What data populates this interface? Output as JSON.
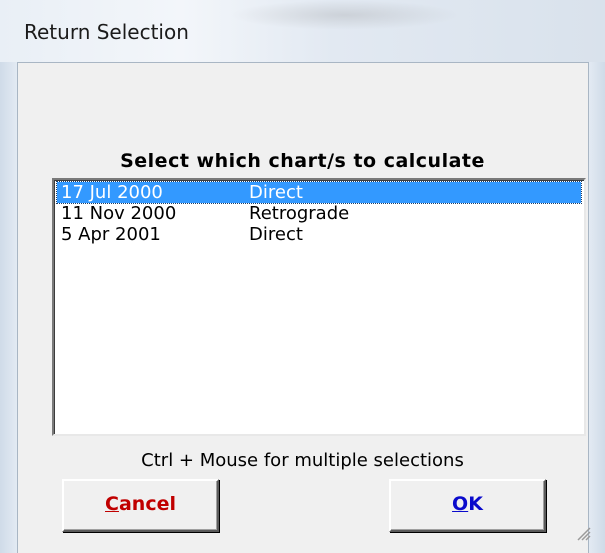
{
  "window": {
    "title": "Return Selection"
  },
  "dialog": {
    "heading": "Select which chart/s to calculate",
    "hint": "Ctrl + Mouse for multiple selections"
  },
  "list": {
    "items": [
      {
        "date": "17 Jul 2000",
        "kind": "Direct",
        "selected": true
      },
      {
        "date": "11 Nov 2000",
        "kind": "Retrograde",
        "selected": false
      },
      {
        "date": "5 Apr 2001",
        "kind": "Direct",
        "selected": false
      }
    ]
  },
  "buttons": {
    "cancel": {
      "mnemonic": "C",
      "rest": "ancel",
      "color": "#c00000"
    },
    "ok": {
      "mnemonic": "O",
      "rest": "K",
      "color": "#0a0acc"
    }
  },
  "colors": {
    "selection": "#3399ff",
    "dialog_bg": "#f0f0f0"
  },
  "icons": {
    "resize_grip": "resize-grip-icon"
  }
}
